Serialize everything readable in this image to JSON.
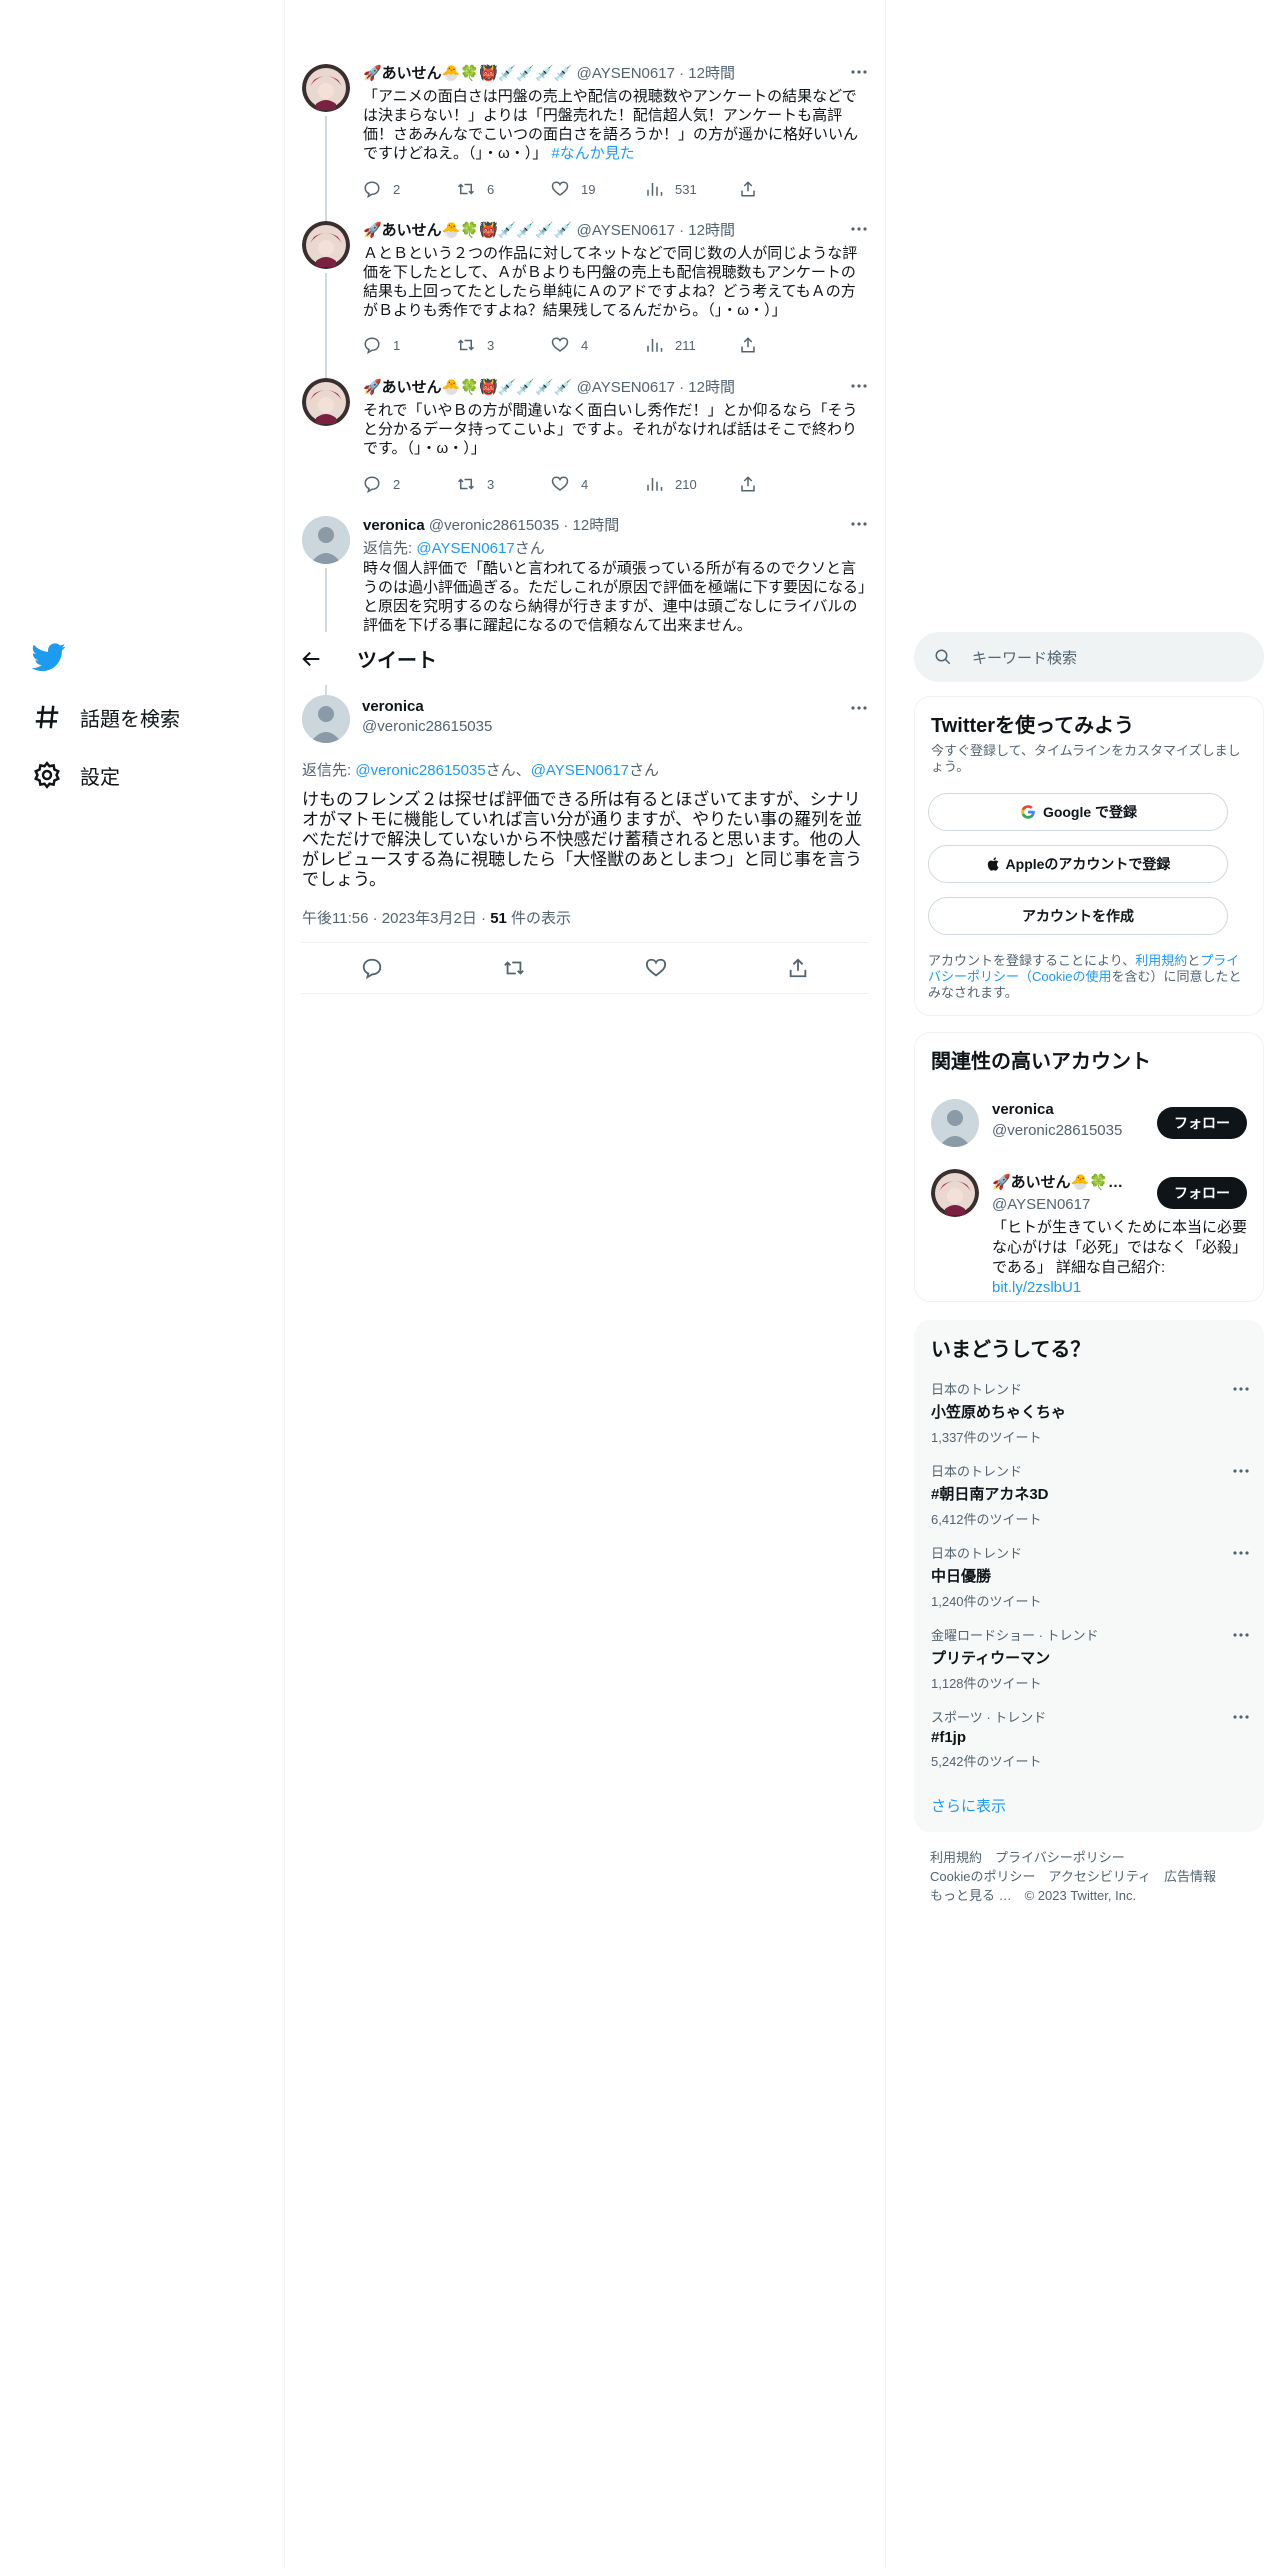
{
  "nav": {
    "items": [
      {
        "label": "話題を検索",
        "icon": "hashtag-icon"
      },
      {
        "label": "設定",
        "icon": "gear-icon"
      }
    ]
  },
  "thread": [
    {
      "name": "🚀あいせん🐣🍀👹💉💉💉💉",
      "handle": "@AYSEN0617",
      "time": "12時間",
      "text": "「アニメの面白さは円盤の売上や配信の視聴数やアンケートの結果などでは決まらない！」よりは「円盤売れた！配信超人気！アンケートも高評価！さあみんなでこいつの面白さを語ろうか！」の方が遥かに格好いいんですけどねえ。（」・ω・）」",
      "hashtag": "#なんか見た",
      "replies": "2",
      "retweets": "6",
      "likes": "19",
      "views": "531"
    },
    {
      "name": "🚀あいせん🐣🍀👹💉💉💉💉",
      "handle": "@AYSEN0617",
      "time": "12時間",
      "text": "ＡとＢという２つの作品に対してネットなどで同じ数の人が同じような評価を下したとして、ＡがＢよりも円盤の売上も配信視聴数もアンケートの結果も上回ってたとしたら単純にＡのアドですよね？どう考えてもＡの方がＢよりも秀作ですよね？結果残してるんだから。（」・ω・）」",
      "hashtag": "",
      "replies": "1",
      "retweets": "3",
      "likes": "4",
      "views": "211"
    },
    {
      "name": "🚀あいせん🐣🍀👹💉💉💉💉",
      "handle": "@AYSEN0617",
      "time": "12時間",
      "text": "それで「いやＢの方が間違いなく面白いし秀作だ！」とか仰るなら「そうと分かるデータ持ってこいよ」ですよ。それがなければ話はそこで終わりです。（」・ω・）」",
      "hashtag": "",
      "replies": "2",
      "retweets": "3",
      "likes": "4",
      "views": "210"
    },
    {
      "name": "veronica",
      "handle": "@veronic28615035",
      "time": "12時間",
      "reply_prefix": "返信先: ",
      "reply_to": "@AYSEN0617",
      "reply_suffix": "さん",
      "text": "時々個人評価で「酷いと言われてるが頑張っている所が有るのでクソと言うのは過小評価過ぎる。ただしこれが原因で評価を極端に下す要因になる」と原因を究明するのなら納得が行きますが、連中は頭ごなしにライバルの評価を下げる事に躍起になるので信頼なんて出来ません。"
    }
  ],
  "header": {
    "title": "ツイート"
  },
  "focus": {
    "name": "veronica",
    "handle": "@veronic28615035",
    "reply_prefix": "返信先: ",
    "reply_to_1": "@veronic28615035",
    "reply_mid": "さん、",
    "reply_to_2": "@AYSEN0617",
    "reply_suffix": "さん",
    "text": "けものフレンズ２は探せば評価できる所は有るとほざいてますが、シナリオがマトモに機能していれば言い分が通りますが、やりたい事の羅列を並べただけで解決していないから不快感だけ蓄積されると思います。他の人がレビュースする為に視聴したら「大怪獣のあとしまつ」と同じ事を言うでしょう。",
    "time": "午後11:56",
    "date": "2023年3月2日",
    "views": "51",
    "views_label": " 件の表示"
  },
  "search": {
    "placeholder": "キーワード検索"
  },
  "signup": {
    "title": "Twitterを使ってみよう",
    "subtitle": "今すぐ登録して、タイムラインをカスタマイズしましょう。",
    "google": "Google で登録",
    "apple": "Appleのアカウントで登録",
    "create": "アカウントを作成",
    "legal_1": "アカウントを登録することにより、",
    "legal_terms": "利用規約",
    "legal_and": "と",
    "legal_privacy": "プライバシーポリシー",
    "legal_cookie": "（Cookieの使用",
    "legal_2": "を含む）に同意したとみなされます。"
  },
  "relevant": {
    "title": "関連性の高いアカウント",
    "follow": "フォロー",
    "accounts": [
      {
        "name": "veronica",
        "handle": "@veronic28615035"
      },
      {
        "name": "🚀あいせん🐣🍀…",
        "handle": "@AYSEN0617",
        "bio": "「ヒトが生きていくために本当に必要な心がけは「必死」ではなく「必殺」である」 詳細な自己紹介:",
        "bio_link": "bit.ly/2zslbU1"
      }
    ]
  },
  "trends": {
    "title": "いまどうしてる？",
    "items": [
      {
        "context": "日本のトレンド",
        "title": "小笠原めちゃくちゃ",
        "count": "1,337件のツイート"
      },
      {
        "context": "日本のトレンド",
        "title": "#朝日南アカネ3D",
        "count": "6,412件のツイート"
      },
      {
        "context": "日本のトレンド",
        "title": "中日優勝",
        "count": "1,240件のツイート"
      },
      {
        "context": "金曜ロードショー · トレンド",
        "title": "プリティウーマン",
        "count": "1,128件のツイート"
      },
      {
        "context": "スポーツ · トレンド",
        "title": "#f1jp",
        "count": "5,242件のツイート"
      }
    ],
    "show_more": "さらに表示"
  },
  "footer": {
    "line1": "利用規約　プライバシーポリシー",
    "line2": "Cookieのポリシー　アクセシビリティ　広告情報",
    "line3": "もっと見る …　© 2023 Twitter, Inc."
  },
  "colors": {
    "accent": "#1d9bf0",
    "text": "#0f1419",
    "secondary": "#536471",
    "border": "#eff3f4"
  }
}
